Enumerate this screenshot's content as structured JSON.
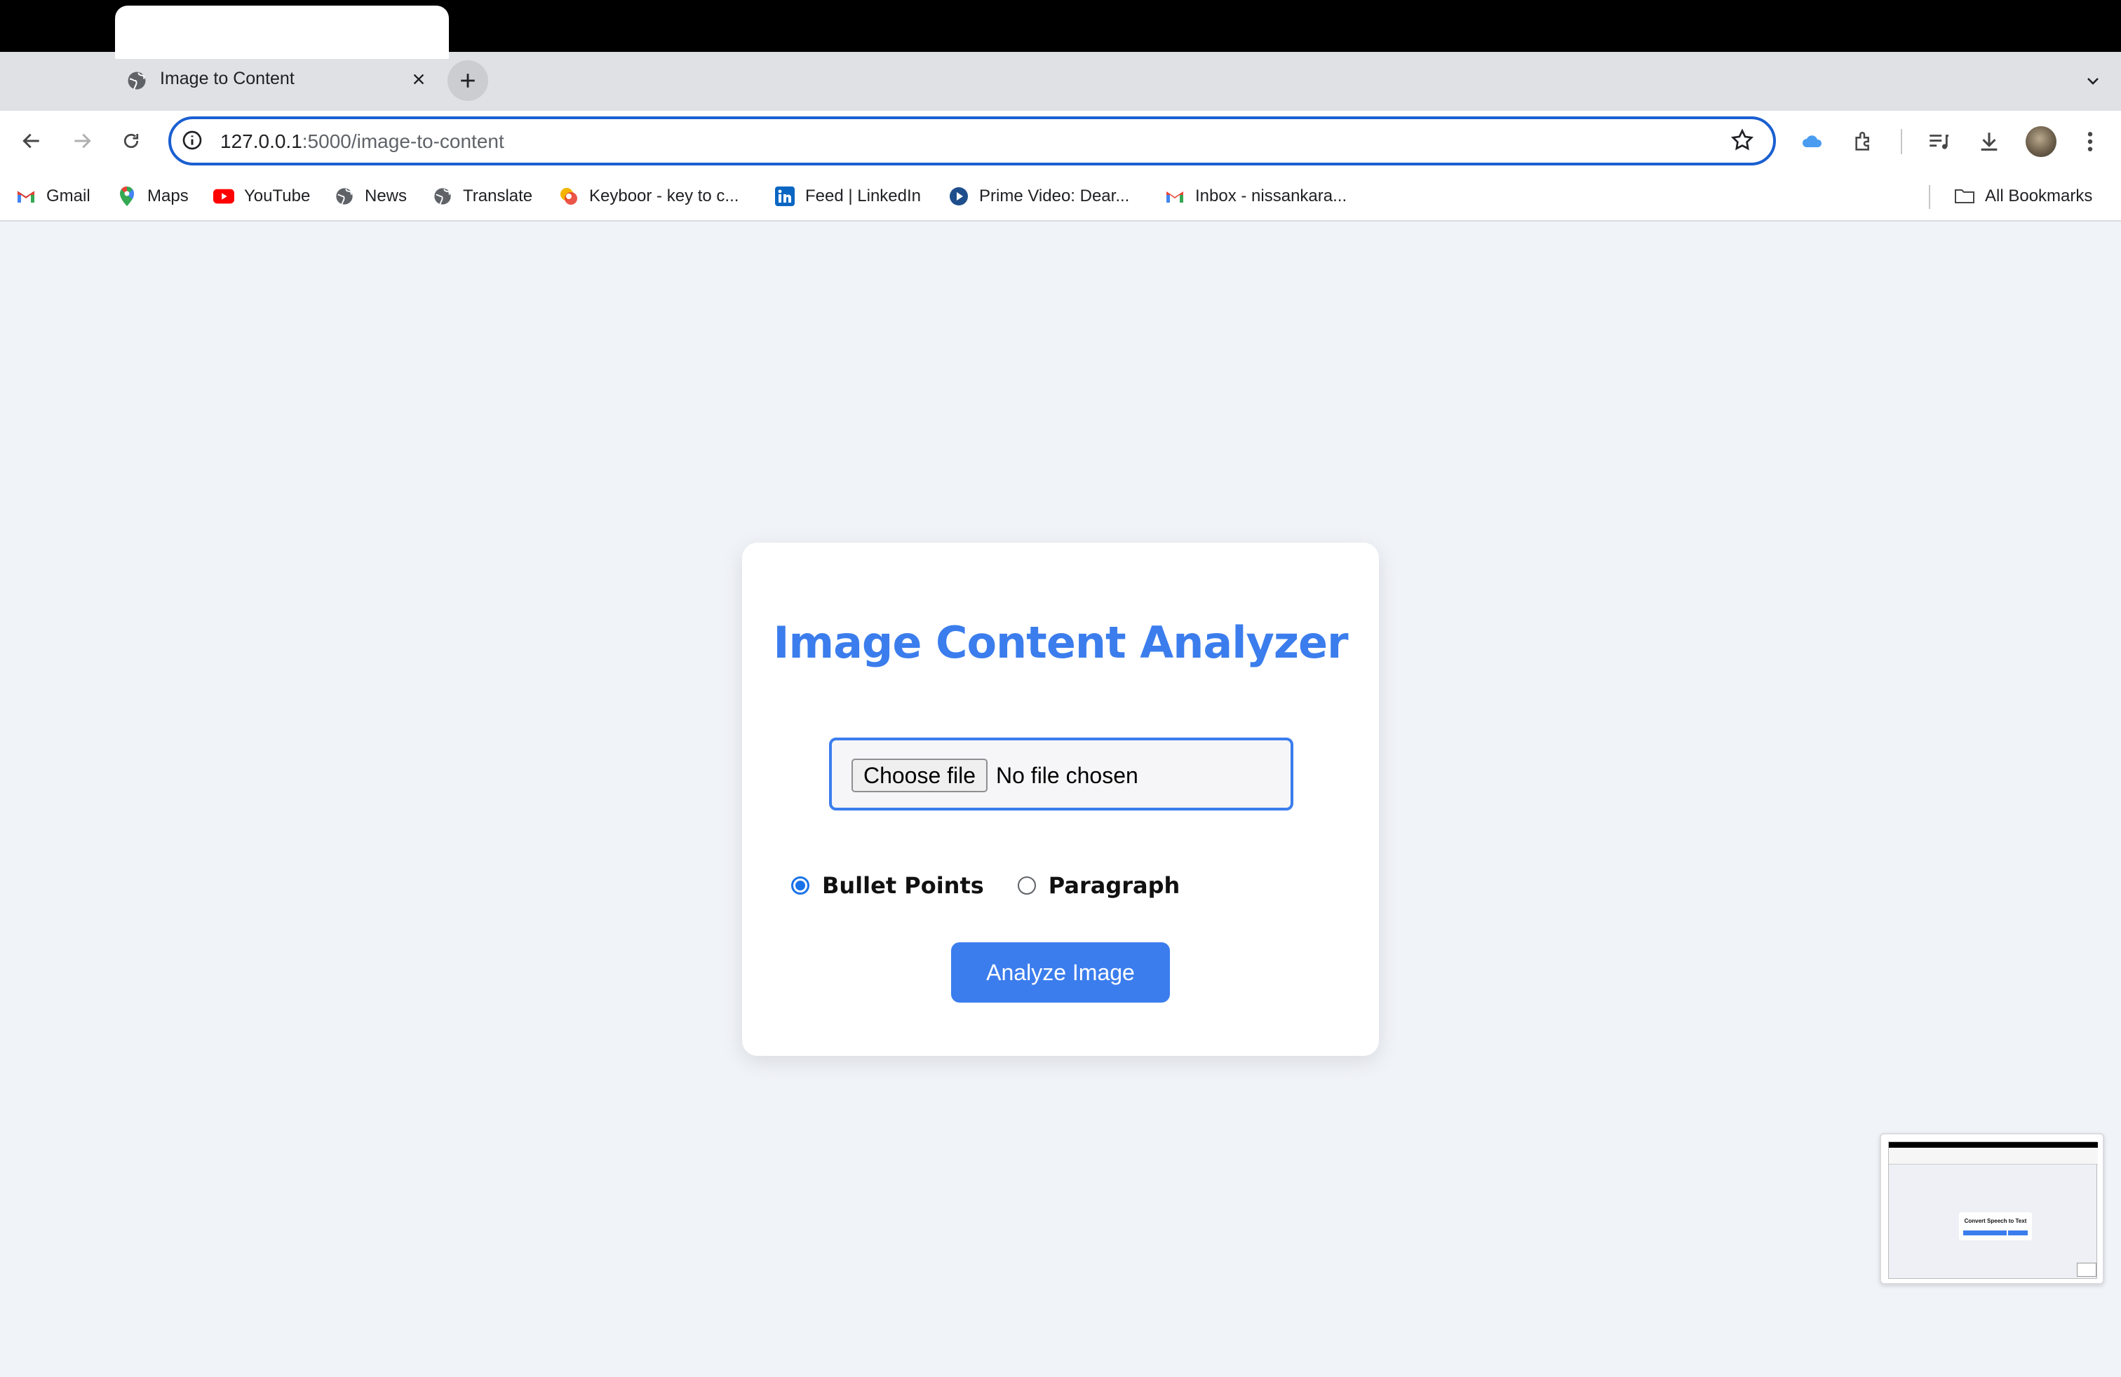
{
  "browser": {
    "tab": {
      "title": "Image to Content",
      "favicon": "globe-icon"
    },
    "address": {
      "host": "127.0.0.1",
      "path": ":5000/image-to-content"
    },
    "bookmarks": [
      {
        "label": "Gmail",
        "icon": "gmail-icon"
      },
      {
        "label": "Maps",
        "icon": "maps-icon"
      },
      {
        "label": "YouTube",
        "icon": "youtube-icon"
      },
      {
        "label": "News",
        "icon": "globe-icon"
      },
      {
        "label": "Translate",
        "icon": "globe-icon"
      },
      {
        "label": "Keyboor - key to c...",
        "icon": "keyboor-icon"
      },
      {
        "label": "Feed | LinkedIn",
        "icon": "linkedin-icon"
      },
      {
        "label": "Prime Video: Dear...",
        "icon": "prime-video-icon"
      },
      {
        "label": "Inbox - nissankara...",
        "icon": "gmail-icon"
      }
    ],
    "all_bookmarks_label": "All Bookmarks"
  },
  "page": {
    "title": "Image Content Analyzer",
    "file_input": {
      "button_label": "Choose file",
      "status": "No file chosen"
    },
    "options": [
      {
        "label": "Bullet Points",
        "checked": true
      },
      {
        "label": "Paragraph",
        "checked": false
      }
    ],
    "submit_label": "Analyze Image"
  },
  "thumbnail": {
    "title": "Convert Speech to Text"
  },
  "colors": {
    "accent": "#3b7ded",
    "background": "#f0f3f8",
    "focus": "#1a5fd1"
  }
}
